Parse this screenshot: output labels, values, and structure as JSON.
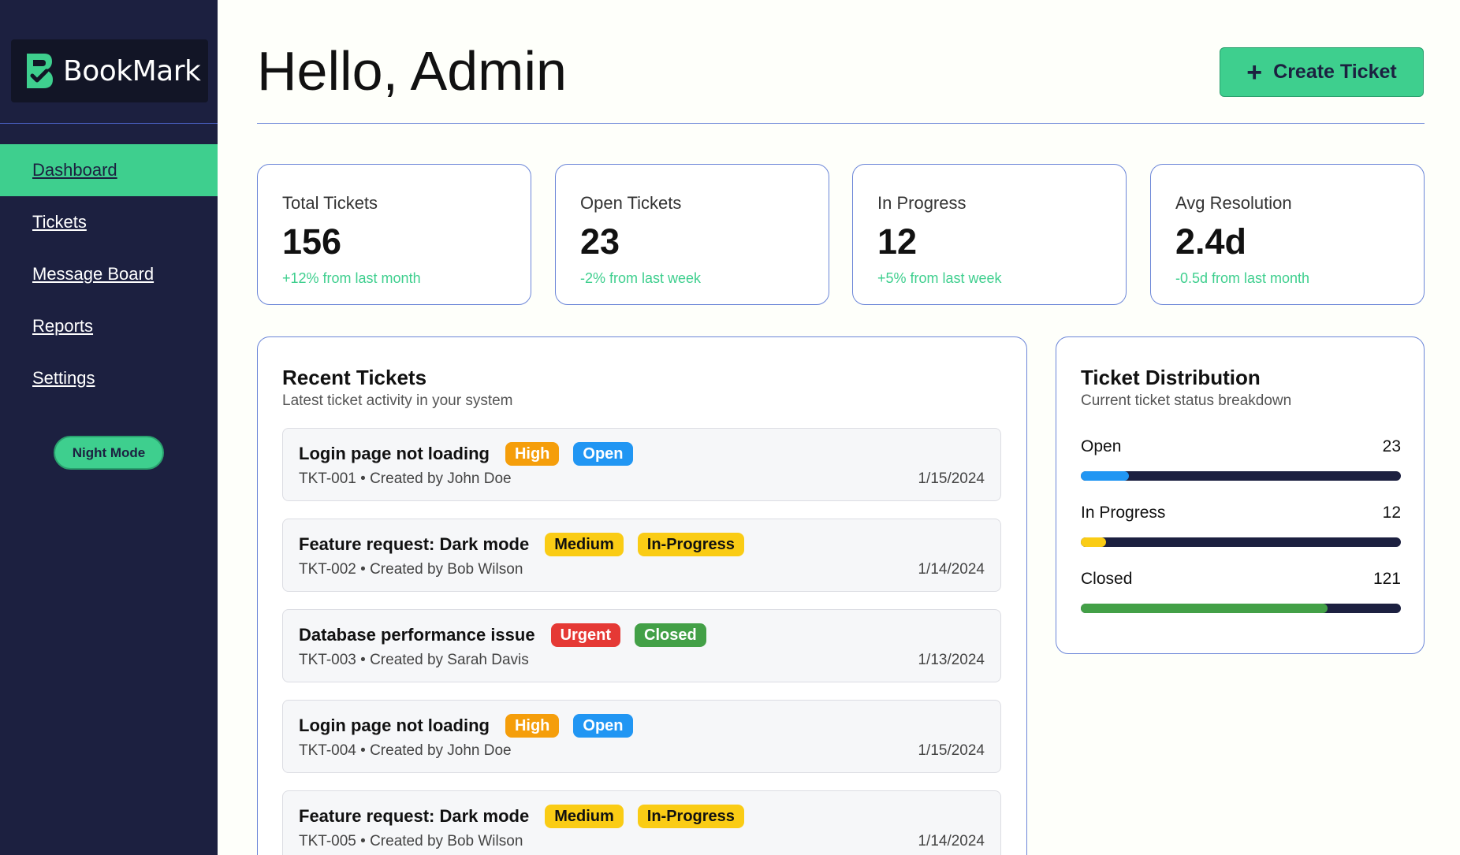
{
  "brand": {
    "name": "BookMark",
    "accent": "#3ecf8e",
    "sidebar_bg": "#1c2040"
  },
  "sidebar": {
    "items": [
      {
        "label": "Dashboard",
        "active": true
      },
      {
        "label": "Tickets",
        "active": false
      },
      {
        "label": "Message Board",
        "active": false
      },
      {
        "label": "Reports",
        "active": false
      },
      {
        "label": "Settings",
        "active": false
      }
    ],
    "night_mode_label": "Night Mode"
  },
  "header": {
    "title": "Hello, Admin",
    "create_button_label": "Create Ticket",
    "create_button_icon": "plus-icon"
  },
  "stats": [
    {
      "label": "Total Tickets",
      "value": "156",
      "change": "+12% from last month"
    },
    {
      "label": "Open Tickets",
      "value": "23",
      "change": "-2% from last week"
    },
    {
      "label": "In Progress",
      "value": "12",
      "change": "+5% from last week"
    },
    {
      "label": "Avg Resolution",
      "value": "2.4d",
      "change": "-0.5d from last month"
    }
  ],
  "recent": {
    "title": "Recent Tickets",
    "subtitle": "Latest ticket activity in your system",
    "tickets": [
      {
        "title": "Login page not loading",
        "priority": "High",
        "priority_color": "#f59e0b",
        "status": "Open",
        "status_color": "#2196f3",
        "meta": "TKT-001 • Created by John Doe",
        "date": "1/15/2024"
      },
      {
        "title": "Feature request: Dark mode",
        "priority": "Medium",
        "priority_color": "#facc15",
        "status": "In-Progress",
        "status_color": "#facc15",
        "meta": "TKT-002 • Created by Bob Wilson",
        "date": "1/14/2024"
      },
      {
        "title": "Database performance issue",
        "priority": "Urgent",
        "priority_color": "#e53935",
        "status": "Closed",
        "status_color": "#43a047",
        "meta": "TKT-003 • Created by Sarah Davis",
        "date": "1/13/2024"
      },
      {
        "title": "Login page not loading",
        "priority": "High",
        "priority_color": "#f59e0b",
        "status": "Open",
        "status_color": "#2196f3",
        "meta": "TKT-004 • Created by John Doe",
        "date": "1/15/2024"
      },
      {
        "title": "Feature request: Dark mode",
        "priority": "Medium",
        "priority_color": "#facc15",
        "status": "In-Progress",
        "status_color": "#facc15",
        "meta": "TKT-005 • Created by Bob Wilson",
        "date": "1/14/2024"
      }
    ]
  },
  "distribution": {
    "title": "Ticket Distribution",
    "subtitle": "Current ticket status breakdown",
    "rows": [
      {
        "label": "Open",
        "count": "23",
        "fraction": 0.15,
        "color": "#2196f3"
      },
      {
        "label": "In Progress",
        "count": "12",
        "fraction": 0.08,
        "color": "#facc15"
      },
      {
        "label": "Closed",
        "count": "121",
        "fraction": 0.77,
        "color": "#43a047"
      }
    ]
  }
}
